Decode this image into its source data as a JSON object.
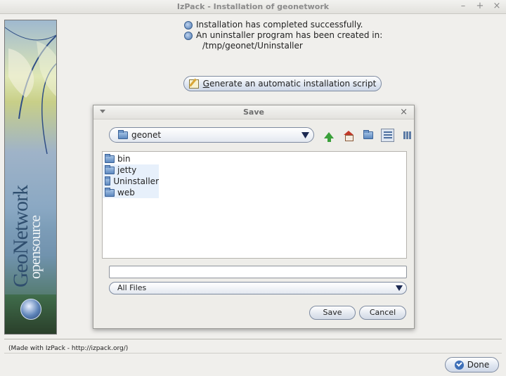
{
  "window": {
    "title": "IzPack - Installation of geonetwork",
    "controls": [
      "–",
      "+",
      "×"
    ]
  },
  "sidebar": {
    "brand_main": "GeoNetwork",
    "brand_sub": "opensource"
  },
  "messages": {
    "line1": "Installation has completed successfully.",
    "line2": "An uninstaller program has been created in:",
    "path": "/tmp/geonet/Uninstaller"
  },
  "generate_button": {
    "mnemonic": "G",
    "rest": "enerate an automatic installation script",
    "icon": "edit-icon"
  },
  "dialog": {
    "title": "Save",
    "location": "geonet",
    "toolbar_icons": [
      "up-folder-icon",
      "home-icon",
      "new-folder-icon",
      "list-view-icon",
      "details-view-icon"
    ],
    "files": [
      "bin",
      "jetty",
      "Uninstaller",
      "web"
    ],
    "filename_value": "",
    "filter": "All Files",
    "save_label": "Save",
    "cancel_label": "Cancel"
  },
  "footer": {
    "credits": "(Made with IzPack - http://izpack.org/)",
    "done_label": "Done"
  }
}
